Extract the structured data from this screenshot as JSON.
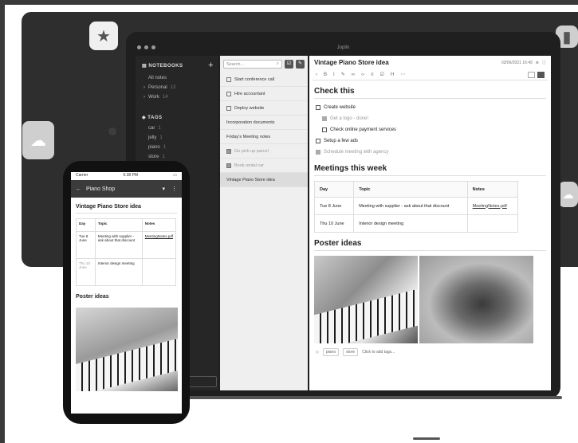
{
  "app": {
    "window_title": "Joplin"
  },
  "sidebar": {
    "notebooks_header": "NOTEBOOKS",
    "add_label": "+",
    "items": [
      {
        "label": "All notes",
        "count": ""
      },
      {
        "label": "Personal",
        "count": "13"
      },
      {
        "label": "Work",
        "count": "14"
      }
    ],
    "tags_header": "TAGS",
    "tags": [
      {
        "label": "car",
        "count": "1"
      },
      {
        "label": "jelly",
        "count": "1"
      },
      {
        "label": "piano",
        "count": "1"
      },
      {
        "label": "store",
        "count": "1"
      }
    ]
  },
  "note_list": {
    "search_placeholder": "Search...",
    "items": [
      {
        "label": "Start conference call",
        "checkbox": true,
        "done": false
      },
      {
        "label": "Hire accountant",
        "checkbox": true,
        "done": false
      },
      {
        "label": "Deploy website",
        "checkbox": true,
        "done": false
      },
      {
        "label": "Incorporation documents",
        "checkbox": false,
        "done": false
      },
      {
        "label": "Friday's Meeting notes",
        "checkbox": false,
        "done": false
      },
      {
        "label": "Go pick up parcel",
        "checkbox": true,
        "done": true
      },
      {
        "label": "Book rental car",
        "checkbox": true,
        "done": true
      },
      {
        "label": "Vintage Piano Store idea",
        "checkbox": false,
        "done": false,
        "selected": true
      }
    ]
  },
  "editor": {
    "title": "Vintage Piano Store idea",
    "timestamp": "03/06/2021 16:49",
    "heading1": "Check this",
    "todos": [
      {
        "label": "Create website",
        "done": false,
        "sub": false
      },
      {
        "label": "Get a logo - done!",
        "done": true,
        "sub": true
      },
      {
        "label": "Check online payment services",
        "done": false,
        "sub": true
      },
      {
        "label": "Setup a few ads",
        "done": false,
        "sub": false
      },
      {
        "label": "Schedule meeting with agency",
        "done": true,
        "sub": false
      }
    ],
    "heading2": "Meetings this week",
    "table": {
      "headers": [
        "Day",
        "Topic",
        "Notes"
      ],
      "rows": [
        [
          "Tue 8 June",
          "Meeting with supplier - ask about that discount",
          "MeetingNotes.pdf"
        ],
        [
          "Thu 10 June",
          "Interior design meeting",
          ""
        ]
      ]
    },
    "heading3": "Poster ideas",
    "tags": [
      "piano",
      "store"
    ],
    "add_tags": "Click to add tags..."
  },
  "phone": {
    "carrier": "Carrier",
    "time": "6:38 PM",
    "nav_title": "Piano Shop",
    "note_title": "Vintage Piano Store idea",
    "table": {
      "headers": [
        "Day",
        "Topic",
        "Notes"
      ],
      "rows": [
        [
          "Tue 8 June",
          "Meeting with supplier - ask about that discount",
          "MeetingNotes.pdf"
        ],
        [
          "Thu 10 June",
          "Interior design meeting",
          ""
        ]
      ]
    },
    "heading": "Poster ideas"
  }
}
